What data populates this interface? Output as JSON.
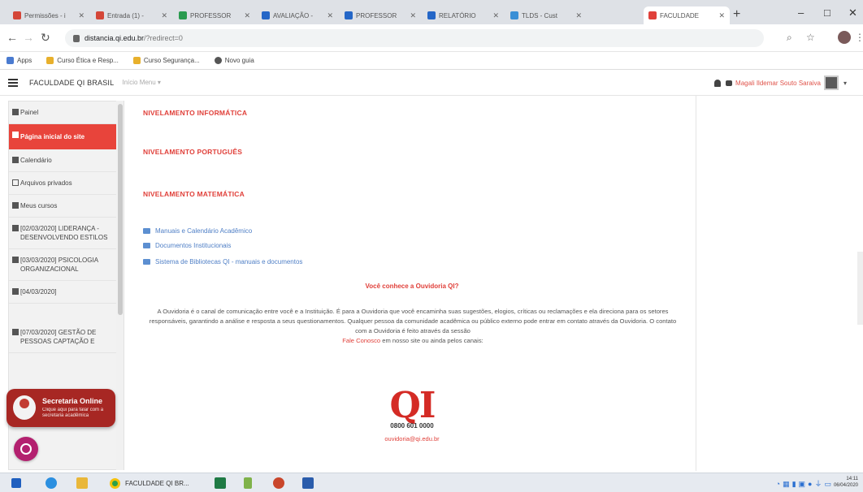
{
  "browser": {
    "tabs": [
      {
        "label": "Permissões - i",
        "color": "#d44638"
      },
      {
        "label": "Entrada (1) - ",
        "color": "#d44638"
      },
      {
        "label": "PROFESSOR",
        "color": "#2a9b4f"
      },
      {
        "label": "AVALIAÇÃO -",
        "color": "#2466c7"
      },
      {
        "label": "PROFESSOR",
        "color": "#2466c7"
      },
      {
        "label": "RELATÓRIO",
        "color": "#2466c7"
      },
      {
        "label": "TLDS - Cust",
        "color": "#3a8fd6"
      },
      {
        "label": "FACULDADE",
        "color": "#e0403a"
      }
    ],
    "address": {
      "host": "distancia.qi.edu.br",
      "path": "/?redirect=0"
    },
    "bookmarks": [
      {
        "label": "Apps",
        "color": "#4a7bd0"
      },
      {
        "label": "Curso Ética e Resp...",
        "color": "#e8b02c"
      },
      {
        "label": "Curso Segurança...",
        "color": "#e8b02c"
      },
      {
        "label": "Novo guia",
        "color": "#555555"
      }
    ]
  },
  "moodle": {
    "site_name": "FACULDADE QI BRASIL",
    "top_links": "Início  Menu ▾",
    "user_name": "Magali Ildemar Souto Saraiva"
  },
  "drawer": {
    "items": [
      {
        "label": "Painel",
        "active": false
      },
      {
        "label": "Página inicial do site",
        "active": true
      },
      {
        "label": "Calendário",
        "active": false
      },
      {
        "label": "Arquivos privados",
        "active": false
      },
      {
        "label": "Meus cursos",
        "active": false
      },
      {
        "label": "[02/03/2020] LIDERANÇA - DESENVOLVENDO ESTILOS",
        "active": false
      },
      {
        "label": "[03/03/2020] PSICOLOGIA ORGANIZACIONAL",
        "active": false
      },
      {
        "label": "[04/03/2020]",
        "active": false
      },
      {
        "label": "[07/03/2020] GESTÃO DE PESSOAS CAPTAÇÃO E",
        "active": false
      }
    ]
  },
  "widgets": {
    "secretaria_title": "Secretaria Online",
    "secretaria_sub": "Clique aqui para falar com a secretaria acadêmica"
  },
  "content": {
    "nivelamento": [
      "NIVELAMENTO INFORMÁTICA",
      "NIVELAMENTO PORTUGUÊS",
      "NIVELAMENTO MATEMÁTICA"
    ],
    "folders": [
      "Manuais e Calendário Acadêmico",
      "Documentos Institucionais",
      "Sistema de Bibliotecas QI - manuais e documentos"
    ],
    "ouvidoria_title": "Você conhece a Ouvidoria QI?",
    "ouvidoria_text": "A Ouvidoria é o canal de comunicação entre você e a Instituição. É para a Ouvidoria que você encaminha suas sugestões, elogios, críticas ou reclamações e ela direciona para os setores responsáveis, garantindo a análise e resposta a seus questionamentos. Qualquer pessoa da comunidade acadêmica ou público externo pode entrar em contato através da Ouvidoria. O contato com a Ouvidoria é feito através da sessão",
    "ouvidoria_link": "Fale Conosco",
    "ouvidoria_tail": "em nosso site ou ainda pelos canais:",
    "logo_text": "QI",
    "phone": "0800 601 0000",
    "email": "ouvidoria@qi.edu.br"
  },
  "taskbar": {
    "app_label": "FACULDADE QI BR...",
    "clock_time": "14:11",
    "clock_date": "06/04/2020"
  }
}
